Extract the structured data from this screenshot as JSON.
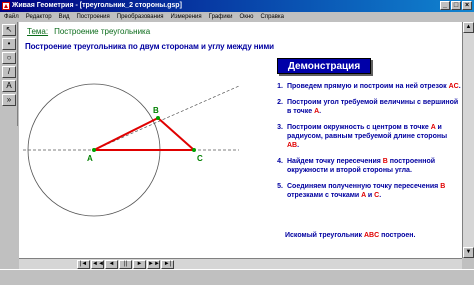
{
  "window": {
    "title": "Живая Геометрия - [треугольник_2 стороны.gsp]",
    "buttons": [
      "_",
      "□",
      "×"
    ]
  },
  "menu": [
    "Файл",
    "Редактор",
    "Вид",
    "Построения",
    "Преобразования",
    "Измерения",
    "Графики",
    "Окно",
    "Справка"
  ],
  "tools": [
    "↖",
    "•",
    "○",
    "/",
    "A",
    "»"
  ],
  "doc": {
    "topic_label": "Тема:",
    "topic_value": "Построение треугольника",
    "heading": "Построение треугольника по двум сторонам и углу между ними",
    "points": {
      "A": "A",
      "B": "B",
      "C": "C"
    },
    "demo_button": "Демонстрация",
    "steps": [
      {
        "num": "1.",
        "parts": [
          "Проведем прямую и построим на ней отрезок ",
          "AC",
          "."
        ]
      },
      {
        "num": "2.",
        "parts": [
          "Построим угол требуемой величины с вершиной в точке ",
          "A",
          "."
        ]
      },
      {
        "num": "3.",
        "parts": [
          "Построим окружность с центром в точке ",
          "A",
          " и радиусом, равным требуемой длине стороны ",
          "AB",
          "."
        ]
      },
      {
        "num": "4.",
        "parts": [
          "Найдем точку пересечения ",
          "B",
          " построенной окружности и второй стороны угла."
        ]
      },
      {
        "num": "5.",
        "parts": [
          "Соединяем полученную точку пересечения ",
          "B",
          " отрезками с точками ",
          "A",
          " и ",
          "C",
          "."
        ]
      }
    ],
    "result": {
      "parts": [
        "Искомый треугольник ",
        "ABC",
        " построен."
      ]
    }
  },
  "colors": {
    "triangle": "#e00000",
    "point": "#00a000",
    "label": "#008000",
    "heading": "#0000a0",
    "topic": "#0a6b1a",
    "demo_bg": "#0000a8"
  },
  "nav_buttons": [
    "|◄",
    "◄◄",
    "◄",
    "||",
    "►",
    "►►",
    "►|"
  ]
}
